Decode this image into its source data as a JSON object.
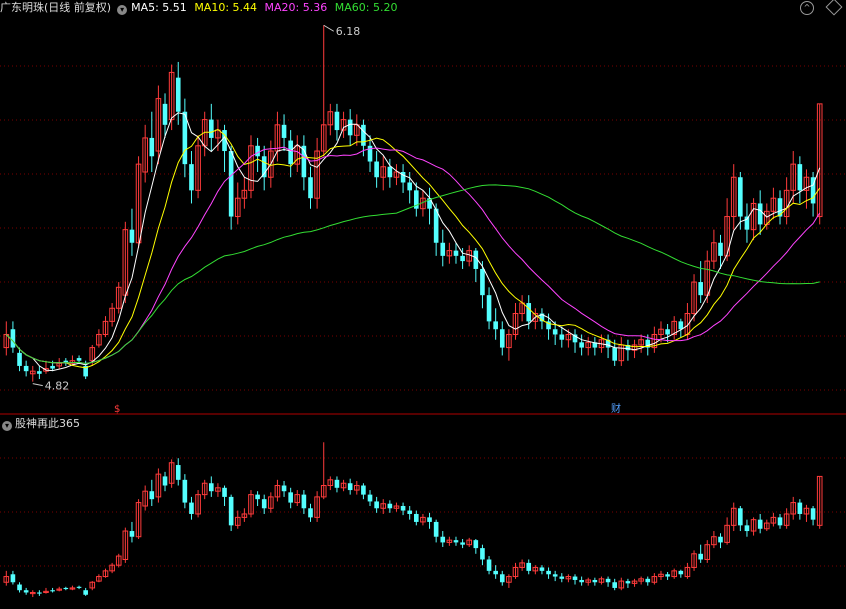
{
  "header": {
    "stock_label": "广东明珠(日线 前复权)",
    "ma5": "MA5: 5.51",
    "ma10": "MA10: 5.44",
    "ma20": "MA20: 5.36",
    "ma60": "MA60: 5.20"
  },
  "sub_panel": {
    "indicator_name": "股神再此365"
  },
  "colors": {
    "background": "#000000",
    "up": "#ff3b3b",
    "down": "#54ffff",
    "ma5": "#ffffff",
    "ma10": "#ffff00",
    "ma20": "#ff44ff",
    "ma60": "#33dd33",
    "grid": "#7a0000"
  },
  "icons": [
    "dropdown-circle-icon",
    "up-chevron-icon",
    "diamond-icon"
  ],
  "chart_data": {
    "type": "candlestick",
    "y_range": [
      4.75,
      6.2
    ],
    "high_label": "6.18",
    "low_label": "4.82",
    "markers": [
      "$",
      "财"
    ],
    "candles": [
      [
        4.95,
        5.0,
        5.05,
        4.92
      ],
      [
        5.02,
        4.95,
        5.05,
        4.93
      ],
      [
        4.93,
        4.88,
        4.95,
        4.86
      ],
      [
        4.88,
        4.86,
        4.9,
        4.84
      ],
      [
        4.85,
        4.86,
        4.88,
        4.82
      ],
      [
        4.86,
        4.85,
        4.88,
        4.83
      ],
      [
        4.86,
        4.87,
        4.9,
        4.85
      ],
      [
        4.88,
        4.87,
        4.9,
        4.86
      ],
      [
        4.88,
        4.89,
        4.91,
        4.87
      ],
      [
        4.9,
        4.89,
        4.91,
        4.88
      ],
      [
        4.89,
        4.9,
        4.92,
        4.88
      ],
      [
        4.91,
        4.9,
        4.92,
        4.89
      ],
      [
        4.88,
        4.84,
        4.9,
        4.83
      ],
      [
        4.9,
        4.95,
        4.96,
        4.88
      ],
      [
        4.96,
        5.0,
        5.02,
        4.95
      ],
      [
        5.0,
        5.05,
        5.07,
        4.99
      ],
      [
        5.05,
        5.1,
        5.12,
        5.03
      ],
      [
        5.1,
        5.18,
        5.2,
        5.08
      ],
      [
        5.15,
        5.4,
        5.43,
        5.12
      ],
      [
        5.4,
        5.35,
        5.48,
        5.3
      ],
      [
        5.35,
        5.65,
        5.68,
        5.33
      ],
      [
        5.62,
        5.75,
        5.8,
        5.58
      ],
      [
        5.75,
        5.68,
        5.85,
        5.62
      ],
      [
        5.7,
        5.9,
        5.95,
        5.65
      ],
      [
        5.88,
        5.8,
        5.92,
        5.75
      ],
      [
        5.82,
        6.0,
        6.03,
        5.78
      ],
      [
        5.98,
        5.85,
        6.04,
        5.8
      ],
      [
        5.85,
        5.65,
        5.9,
        5.6
      ],
      [
        5.65,
        5.55,
        5.7,
        5.5
      ],
      [
        5.55,
        5.72,
        5.76,
        5.52
      ],
      [
        5.72,
        5.82,
        5.85,
        5.68
      ],
      [
        5.82,
        5.75,
        5.88,
        5.7
      ],
      [
        5.75,
        5.78,
        5.82,
        5.7
      ],
      [
        5.78,
        5.7,
        5.8,
        5.62
      ],
      [
        5.7,
        5.45,
        5.72,
        5.4
      ],
      [
        5.45,
        5.52,
        5.58,
        5.42
      ],
      [
        5.52,
        5.55,
        5.6,
        5.48
      ],
      [
        5.55,
        5.72,
        5.76,
        5.52
      ],
      [
        5.72,
        5.68,
        5.75,
        5.62
      ],
      [
        5.68,
        5.6,
        5.72,
        5.55
      ],
      [
        5.6,
        5.7,
        5.74,
        5.56
      ],
      [
        5.7,
        5.8,
        5.85,
        5.66
      ],
      [
        5.8,
        5.75,
        5.84,
        5.7
      ],
      [
        5.74,
        5.65,
        5.78,
        5.6
      ],
      [
        5.65,
        5.72,
        5.76,
        5.62
      ],
      [
        5.72,
        5.6,
        5.76,
        5.55
      ],
      [
        5.6,
        5.52,
        5.64,
        5.48
      ],
      [
        5.52,
        5.7,
        5.75,
        5.48
      ],
      [
        5.7,
        5.8,
        6.18,
        5.68
      ],
      [
        5.8,
        5.85,
        5.88,
        5.76
      ],
      [
        5.85,
        5.78,
        5.88,
        5.74
      ],
      [
        5.78,
        5.82,
        5.85,
        5.75
      ],
      [
        5.82,
        5.76,
        5.86,
        5.72
      ],
      [
        5.76,
        5.8,
        5.84,
        5.72
      ],
      [
        5.8,
        5.72,
        5.82,
        5.68
      ],
      [
        5.72,
        5.66,
        5.76,
        5.62
      ],
      [
        5.66,
        5.6,
        5.7,
        5.56
      ],
      [
        5.6,
        5.64,
        5.68,
        5.55
      ],
      [
        5.64,
        5.6,
        5.67,
        5.56
      ],
      [
        5.6,
        5.62,
        5.65,
        5.57
      ],
      [
        5.62,
        5.58,
        5.65,
        5.54
      ],
      [
        5.58,
        5.55,
        5.62,
        5.5
      ],
      [
        5.55,
        5.48,
        5.58,
        5.45
      ],
      [
        5.48,
        5.52,
        5.55,
        5.45
      ],
      [
        5.52,
        5.48,
        5.56,
        5.42
      ],
      [
        5.48,
        5.35,
        5.5,
        5.3
      ],
      [
        5.35,
        5.3,
        5.4,
        5.26
      ],
      [
        5.3,
        5.32,
        5.35,
        5.27
      ],
      [
        5.32,
        5.3,
        5.35,
        5.27
      ],
      [
        5.3,
        5.28,
        5.33,
        5.25
      ],
      [
        5.28,
        5.32,
        5.34,
        5.26
      ],
      [
        5.32,
        5.25,
        5.33,
        5.2
      ],
      [
        5.25,
        5.15,
        5.28,
        5.1
      ],
      [
        5.15,
        5.05,
        5.18,
        5.02
      ],
      [
        5.05,
        5.02,
        5.1,
        4.98
      ],
      [
        5.02,
        4.95,
        5.05,
        4.92
      ],
      [
        4.95,
        5.0,
        5.02,
        4.9
      ],
      [
        5.0,
        5.08,
        5.12,
        4.98
      ],
      [
        5.08,
        5.12,
        5.15,
        5.05
      ],
      [
        5.12,
        5.05,
        5.15,
        5.02
      ],
      [
        5.05,
        5.08,
        5.1,
        5.02
      ],
      [
        5.08,
        5.05,
        5.1,
        5.02
      ],
      [
        5.05,
        5.02,
        5.08,
        4.98
      ],
      [
        5.02,
        5.0,
        5.05,
        4.96
      ],
      [
        5.0,
        4.98,
        5.03,
        4.95
      ],
      [
        4.98,
        5.0,
        5.02,
        4.95
      ],
      [
        5.0,
        4.97,
        5.02,
        4.93
      ],
      [
        4.97,
        4.95,
        5.0,
        4.92
      ],
      [
        4.95,
        4.97,
        4.99,
        4.92
      ],
      [
        4.97,
        4.95,
        4.99,
        4.92
      ],
      [
        4.95,
        4.98,
        5.0,
        4.93
      ],
      [
        4.98,
        4.95,
        5.0,
        4.91
      ],
      [
        4.95,
        4.9,
        4.98,
        4.88
      ],
      [
        4.9,
        4.96,
        4.99,
        4.88
      ],
      [
        4.96,
        4.94,
        4.98,
        4.9
      ],
      [
        4.94,
        4.96,
        4.98,
        4.91
      ],
      [
        4.96,
        4.98,
        5.0,
        4.93
      ],
      [
        4.98,
        4.95,
        5.0,
        4.92
      ],
      [
        4.95,
        5.0,
        5.03,
        4.93
      ],
      [
        5.0,
        5.02,
        5.05,
        4.97
      ],
      [
        5.02,
        5.0,
        5.04,
        4.97
      ],
      [
        5.0,
        5.05,
        5.07,
        4.98
      ],
      [
        5.05,
        5.02,
        5.06,
        4.99
      ],
      [
        5.0,
        5.08,
        5.12,
        4.98
      ],
      [
        5.08,
        5.2,
        5.23,
        5.05
      ],
      [
        5.2,
        5.15,
        5.28,
        5.12
      ],
      [
        5.15,
        5.28,
        5.32,
        5.12
      ],
      [
        5.28,
        5.35,
        5.4,
        5.25
      ],
      [
        5.35,
        5.3,
        5.38,
        5.25
      ],
      [
        5.3,
        5.45,
        5.52,
        5.28
      ],
      [
        5.45,
        5.6,
        5.65,
        5.4
      ],
      [
        5.6,
        5.45,
        5.62,
        5.4
      ],
      [
        5.45,
        5.4,
        5.5,
        5.35
      ],
      [
        5.4,
        5.5,
        5.52,
        5.36
      ],
      [
        5.5,
        5.42,
        5.55,
        5.38
      ],
      [
        5.42,
        5.47,
        5.5,
        5.4
      ],
      [
        5.47,
        5.52,
        5.56,
        5.44
      ],
      [
        5.52,
        5.45,
        5.55,
        5.42
      ],
      [
        5.45,
        5.55,
        5.6,
        5.42
      ],
      [
        5.55,
        5.65,
        5.7,
        5.5
      ],
      [
        5.65,
        5.55,
        5.68,
        5.5
      ],
      [
        5.55,
        5.6,
        5.63,
        5.48
      ],
      [
        5.6,
        5.5,
        5.62,
        5.45
      ],
      [
        5.45,
        5.88,
        5.88,
        5.42
      ]
    ]
  }
}
